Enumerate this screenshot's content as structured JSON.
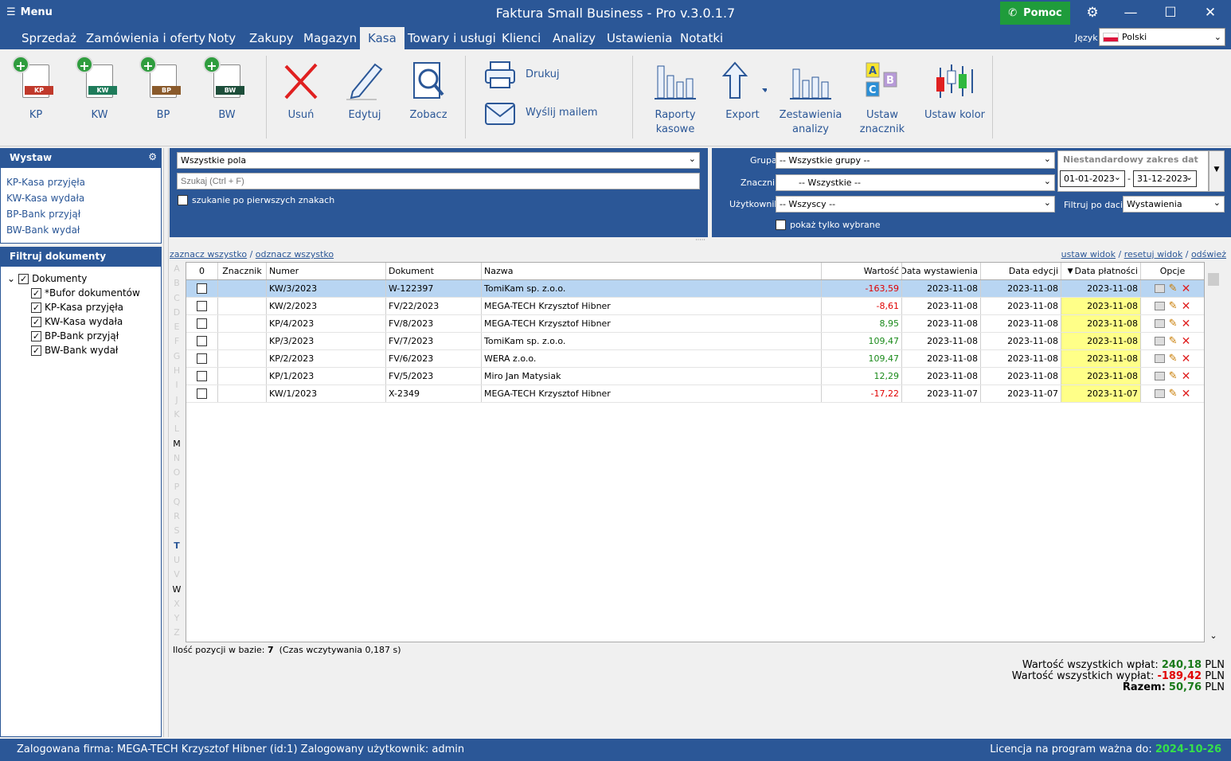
{
  "app": {
    "menu_label": "Menu",
    "title": "Faktura Small Business - Pro v.3.0.1.7",
    "help": "Pomoc"
  },
  "menu": [
    "Sprzedaż",
    "Zamówienia i oferty",
    "Noty",
    "Zakupy",
    "Magazyn",
    "Kasa",
    "Towary i usługi",
    "Klienci",
    "Analizy",
    "Ustawienia",
    "Notatki"
  ],
  "lang": {
    "label": "Język",
    "value": "Polski"
  },
  "ribbon": {
    "kp": "KP",
    "kw": "KW",
    "bp": "BP",
    "bw": "BW",
    "delete": "Usuń",
    "edit": "Edytuj",
    "view": "Zobacz",
    "print": "Drukuj",
    "mail": "Wyślij mailem",
    "reports": "Raporty kasowe",
    "export": "Export",
    "stats": "Zestawienia analizy",
    "marker": "Ustaw znacznik",
    "color": "Ustaw kolor"
  },
  "left": {
    "issue_title": "Wystaw",
    "issue_links": [
      "KP-Kasa przyjęła",
      "KW-Kasa wydała",
      "BP-Bank przyjął",
      "BW-Bank wydał"
    ],
    "filter_title": "Filtruj dokumenty",
    "tree_root": "Dokumenty",
    "tree_items": [
      "*Bufor dokumentów",
      "KP-Kasa przyjęła",
      "KW-Kasa wydała",
      "BP-Bank przyjął",
      "BW-Bank wydał"
    ]
  },
  "filter": {
    "field": "Wszystkie pola",
    "search_placeholder": "Szukaj (Ctrl + F)",
    "first_chars": "szukanie po pierwszych znakach",
    "group_lbl": "Grupa",
    "group": "-- Wszystkie grupy --",
    "marker_lbl": "Znacznik",
    "marker": "-- Wszystkie --",
    "user_lbl": "Użytkownik",
    "user": "-- Wszyscy --",
    "only_selected": "pokaż tylko wybrane",
    "range_title": "Niestandardowy zakres dat",
    "date_from": "01-01-2023",
    "date_to": "31-12-2023",
    "date_filter_lbl": "Filtruj po dacie",
    "date_filter": "Wystawienia"
  },
  "links": {
    "select_all": "zaznacz wszystko",
    "unselect_all": "odznacz wszystko",
    "set_view": "ustaw widok",
    "reset_view": "resetuj widok",
    "refresh": "odśwież"
  },
  "alphabet": [
    "A",
    "B",
    "C",
    "D",
    "E",
    "F",
    "G",
    "H",
    "I",
    "J",
    "K",
    "L",
    "M",
    "N",
    "O",
    "P",
    "Q",
    "R",
    "S",
    "T",
    "U",
    "V",
    "W",
    "X",
    "Y",
    "Z"
  ],
  "columns": {
    "check": "0",
    "marker": "Znacznik",
    "number": "Numer",
    "doc": "Dokument",
    "name": "Nazwa",
    "value": "Wartość",
    "issue": "Data wystawienia",
    "edit": "Data edycji",
    "pay": "Data płatności",
    "opts": "Opcje"
  },
  "rows": [
    {
      "number": "KW/3/2023",
      "doc": "W-122397",
      "name": "TomiKam sp. z.o.o.",
      "value": "-163,59",
      "issue": "2023-11-08",
      "edit": "2023-11-08",
      "pay": "2023-11-08"
    },
    {
      "number": "KW/2/2023",
      "doc": "FV/22/2023",
      "name": "MEGA-TECH Krzysztof Hibner",
      "value": "-8,61",
      "issue": "2023-11-08",
      "edit": "2023-11-08",
      "pay": "2023-11-08"
    },
    {
      "number": "KP/4/2023",
      "doc": "FV/8/2023",
      "name": "MEGA-TECH Krzysztof Hibner",
      "value": "8,95",
      "issue": "2023-11-08",
      "edit": "2023-11-08",
      "pay": "2023-11-08"
    },
    {
      "number": "KP/3/2023",
      "doc": "FV/7/2023",
      "name": "TomiKam sp. z.o.o.",
      "value": "109,47",
      "issue": "2023-11-08",
      "edit": "2023-11-08",
      "pay": "2023-11-08"
    },
    {
      "number": "KP/2/2023",
      "doc": "FV/6/2023",
      "name": "WERA z.o.o.",
      "value": "109,47",
      "issue": "2023-11-08",
      "edit": "2023-11-08",
      "pay": "2023-11-08"
    },
    {
      "number": "KP/1/2023",
      "doc": "FV/5/2023",
      "name": "Miro Jan Matysiak",
      "value": "12,29",
      "issue": "2023-11-08",
      "edit": "2023-11-08",
      "pay": "2023-11-08"
    },
    {
      "number": "KW/1/2023",
      "doc": "X-2349",
      "name": "MEGA-TECH Krzysztof Hibner",
      "value": "-17,22",
      "issue": "2023-11-07",
      "edit": "2023-11-07",
      "pay": "2023-11-07"
    }
  ],
  "status": {
    "count_lbl": "Ilość pozycji w bazie:",
    "count": "7",
    "load": "(Czas wczytywania 0,187 s)"
  },
  "totals": {
    "in_lbl": "Wartość wszystkich wpłat:",
    "in": "240,18",
    "out_lbl": "Wartość wszystkich wypłat:",
    "out": "-189,42",
    "sum_lbl": "Razem:",
    "sum": "50,76",
    "cur": "PLN"
  },
  "footer": {
    "left": "Zalogowana firma: MEGA-TECH Krzysztof Hibner (id:1) Zalogowany użytkownik: admin",
    "right_lbl": "Licencja na program ważna do:",
    "right_date": "2024-10-26"
  }
}
